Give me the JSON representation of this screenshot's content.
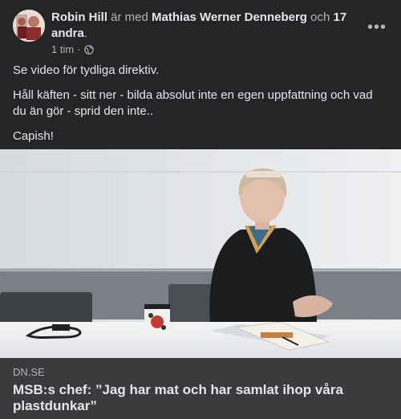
{
  "post": {
    "author": "Robin Hill",
    "with_text": "är med",
    "tagged_person": "Mathias Werner Denneberg",
    "and_text": "och",
    "others": "17 andra",
    "period": ".",
    "timestamp": "1 tim",
    "separator": "·",
    "audience_icon": "globe-icon",
    "more_icon": "more-options-icon",
    "more_label": "•••",
    "paragraphs": [
      "Se video för tydliga direktiv.",
      "Håll käften - sitt ner - bilda absolut inte en egen uppfattning och vad du än gör - sprid den inte..",
      "Capish!"
    ]
  },
  "link_preview": {
    "domain": "DN.SE",
    "headline": "MSB:s chef: ”Jag har mat och har samlat ihop våra plastdunkar”"
  },
  "colors": {
    "background": "#242526",
    "text_primary": "#e4e6eb",
    "text_secondary": "#b0b3b8",
    "link_footer": "#3a3b3c"
  }
}
